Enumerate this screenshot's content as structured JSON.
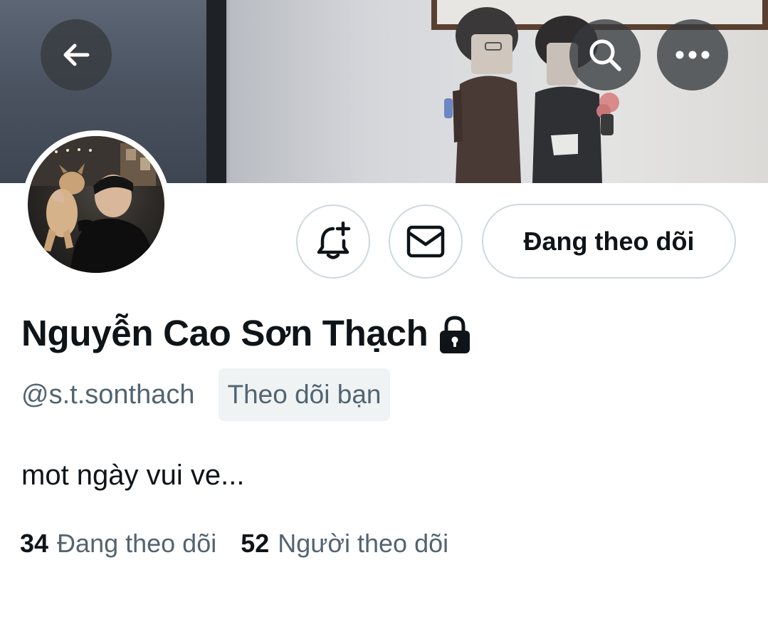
{
  "header": {
    "back_icon": "arrow-left-icon",
    "search_icon": "search-icon",
    "more_icon": "more-horizontal-icon"
  },
  "actions": {
    "notify_icon": "bell-plus-icon",
    "message_icon": "envelope-icon",
    "follow_label": "Đang theo dõi"
  },
  "profile": {
    "display_name": "Nguyễn Cao Sơn Thạch",
    "protected_icon": "lock-icon",
    "handle": "@s.t.sonthach",
    "follows_you_badge": "Theo dõi bạn",
    "bio": "mot ngày vui ve..."
  },
  "stats": {
    "following_count": "34",
    "following_label": "Đang theo dõi",
    "followers_count": "52",
    "followers_label": "Người theo dõi"
  },
  "colors": {
    "text_primary": "#0f1419",
    "text_secondary": "#536471",
    "border": "#cfd9de",
    "badge_bg": "#eff3f4",
    "overlay_button": "#363a3e"
  }
}
